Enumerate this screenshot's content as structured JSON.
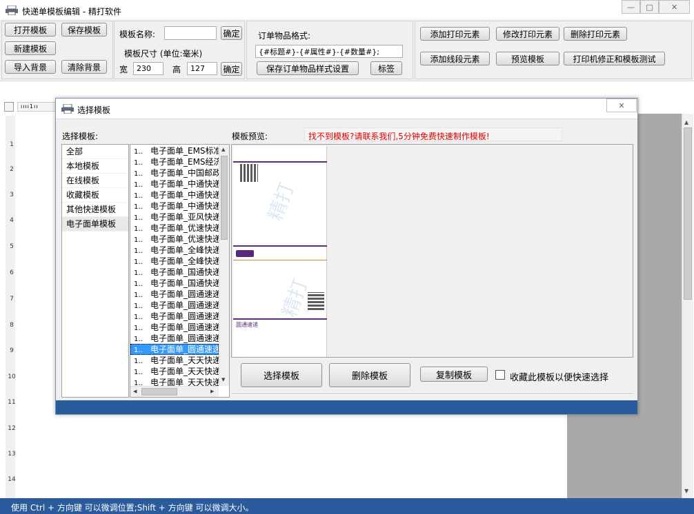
{
  "window": {
    "title": "快递单模板编辑 - 精打软件"
  },
  "toolbar": {
    "open": "打开模板",
    "save": "保存模板",
    "new": "新建模板",
    "import_bg": "导入背景",
    "clear_bg": "清除背景",
    "template_name_label": "模板名称:",
    "template_name_value": "",
    "confirm": "确定",
    "size_label": "模板尺寸 (单位:毫米)",
    "width_label": "宽",
    "width_value": "230",
    "height_label": "高",
    "height_value": "127",
    "order_format_label": "订单物品格式:",
    "order_format_value": "{#标题#}-{#属性#}-{#数量#};",
    "save_order_format": "保存订单物品样式设置",
    "tag": "标签",
    "add_print": "添加打印元素",
    "modify_print": "修改打印元素",
    "delete_print": "删除打印元素",
    "add_line": "添加线段元素",
    "preview": "预览模板",
    "printer_fix": "打印机修正和模板测试"
  },
  "ruler_numbers": [
    "1",
    "2",
    "3",
    "4",
    "5",
    "6",
    "7",
    "8",
    "9",
    "10",
    "11",
    "12",
    "13",
    "14"
  ],
  "dialog": {
    "title": "选择模板",
    "select_label": "选择模板:",
    "preview_label": "模板预览:",
    "notice": "找不到模板?请联系我们,5分钟免费快速制作模板!",
    "categories": [
      "全部",
      "本地模板",
      "在线模板",
      "收藏模板",
      "其他快递模板",
      "电子面单模板"
    ],
    "selected_category": "电子面单模板",
    "templates": [
      {
        "num": "1..",
        "name": "电子面单_EMS标准"
      },
      {
        "num": "1..",
        "name": "电子面单_EMS经济"
      },
      {
        "num": "1..",
        "name": "电子面单_中国邮政"
      },
      {
        "num": "1..",
        "name": "电子面单_中通快递"
      },
      {
        "num": "1..",
        "name": "电子面单_中通快递"
      },
      {
        "num": "1..",
        "name": "电子面单_中通快递"
      },
      {
        "num": "1..",
        "name": "电子面单_亚风快递"
      },
      {
        "num": "1..",
        "name": "电子面单_优速快递"
      },
      {
        "num": "1..",
        "name": "电子面单_优速快递"
      },
      {
        "num": "1..",
        "name": "电子面单_全峰快递"
      },
      {
        "num": "1..",
        "name": "电子面单_全峰快递"
      },
      {
        "num": "1..",
        "name": "电子面单_国通快递"
      },
      {
        "num": "1..",
        "name": "电子面单_国通快递"
      },
      {
        "num": "1..",
        "name": "电子面单_圆通速递"
      },
      {
        "num": "1..",
        "name": "电子面单_圆通速递"
      },
      {
        "num": "1..",
        "name": "电子面单_圆通速递"
      },
      {
        "num": "1..",
        "name": "电子面单_圆通速递"
      },
      {
        "num": "1..",
        "name": "电子面单_圆通速递"
      },
      {
        "num": "1..",
        "name": "电子面单_圆通速递"
      },
      {
        "num": "1..",
        "name": "电子面单_天天快递"
      },
      {
        "num": "1..",
        "name": "电子面单_天天快递"
      },
      {
        "num": "1..",
        "name": "电子面单_天天快递"
      }
    ],
    "selected_template_index": 18,
    "preview_watermark": "精打",
    "preview_footer": "圆通速递",
    "select_button": "选择模板",
    "delete_button": "删除模板",
    "copy_button": "复制模板",
    "favorite_label": "收藏此模板以便快速选择",
    "favorite_checked": false
  },
  "status_bar": {
    "text": "使用 Ctrl + 方向键 可以微调位置;Shift + 方向键 可以微调大小。"
  },
  "colors": {
    "status_bg": "#2a5b9c",
    "notice": "#e00000",
    "selected": "#3399ff",
    "preview_border": "#5a2a7a"
  }
}
